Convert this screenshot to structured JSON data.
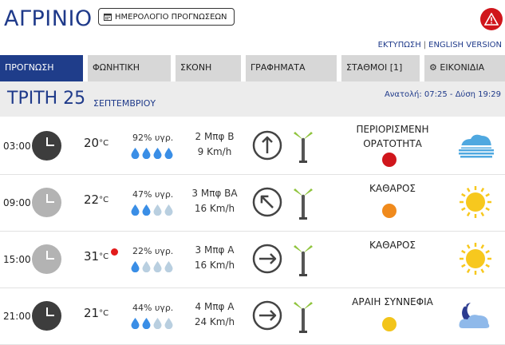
{
  "header": {
    "city": "ΑΓΡΙΝΙΟ",
    "calendar_button": "ΗΜΕΡΟΛΟΓΙΟ ΠΡΟΓΝΩΣΕΩΝ",
    "calendar_icon": "calendar-icon",
    "alert_icon": "warning-icon",
    "print_link": "ΕΚΤΥΠΩΣΗ",
    "separator": "|",
    "english_link": "ENGLISH VERSION"
  },
  "tabs": [
    {
      "label": "ΠΡΟΓΝΩΣΗ",
      "active": true
    },
    {
      "label": "ΦΩΝΗΤΙΚΗ",
      "active": false
    },
    {
      "label": "ΣΚΟΝΗ",
      "active": false
    },
    {
      "label": "ΓΡΑΦΗΜΑΤΑ",
      "active": false
    },
    {
      "label": "ΣΤΑΘΜΟΙ [1]",
      "active": false
    },
    {
      "label": "ΕΙΚΟΝΙΔΙΑ",
      "active": false,
      "icon": "gear-icon"
    }
  ],
  "day": {
    "label": "ΤΡΙΤΗ 25",
    "month": "ΣΕΠΤΕΜΒΡΙΟΥ",
    "sun": "Ανατολή: 07:25 - Δύση 19:29"
  },
  "colors": {
    "brand": "#1f3d8a",
    "tab_bg": "#d7d7d7",
    "alert": "#d0161c",
    "drop_full": "#3a8ee6",
    "drop_empty": "#b9cfe0",
    "sun": "#f7c81e",
    "cloud": "#4fa8e0"
  },
  "rows": [
    {
      "time": "03:00",
      "clock_color": "#3d3d3d",
      "temp": "20",
      "unit": "°C",
      "hot": false,
      "hum": "92% υγρ.",
      "drops": 4,
      "wind1": "2 Μπφ Β",
      "wind2": "9 Km/h",
      "direction": "N",
      "cond1": "ΠΕΡΙΟΡΙΣΜΕΝΗ",
      "cond2": "ΟΡΑΤΟΤΗΤΑ",
      "vis_color": "#d0161c",
      "weather_icon": "fog-icon"
    },
    {
      "time": "09:00",
      "clock_color": "#b3b3b3",
      "temp": "22",
      "unit": "°C",
      "hot": false,
      "hum": "47% υγρ.",
      "drops": 2,
      "wind1": "3 Μπφ ΒΑ",
      "wind2": "16 Km/h",
      "direction": "NE",
      "cond1": "ΚΑΘΑΡΟΣ",
      "cond2": "",
      "vis_color": "#f08a1c",
      "weather_icon": "sun-icon"
    },
    {
      "time": "15:00",
      "clock_color": "#b3b3b3",
      "temp": "31",
      "unit": "°C",
      "hot": true,
      "hum": "22% υγρ.",
      "drops": 1,
      "wind1": "3 Μπφ Α",
      "wind2": "16 Km/h",
      "direction": "E",
      "cond1": "ΚΑΘΑΡΟΣ",
      "cond2": "",
      "vis_color": "",
      "weather_icon": "sun-icon"
    },
    {
      "time": "21:00",
      "clock_color": "#3d3d3d",
      "temp": "21",
      "unit": "°C",
      "hot": false,
      "hum": "44% υγρ.",
      "drops": 2,
      "wind1": "4 Μπφ Α",
      "wind2": "24 Km/h",
      "direction": "E",
      "cond1": "ΑΡΑΙΗ ΣΥΝΝΕΦΙΑ",
      "cond2": "",
      "vis_color": "#f2c41a",
      "weather_icon": "moon-cloud-icon"
    }
  ]
}
